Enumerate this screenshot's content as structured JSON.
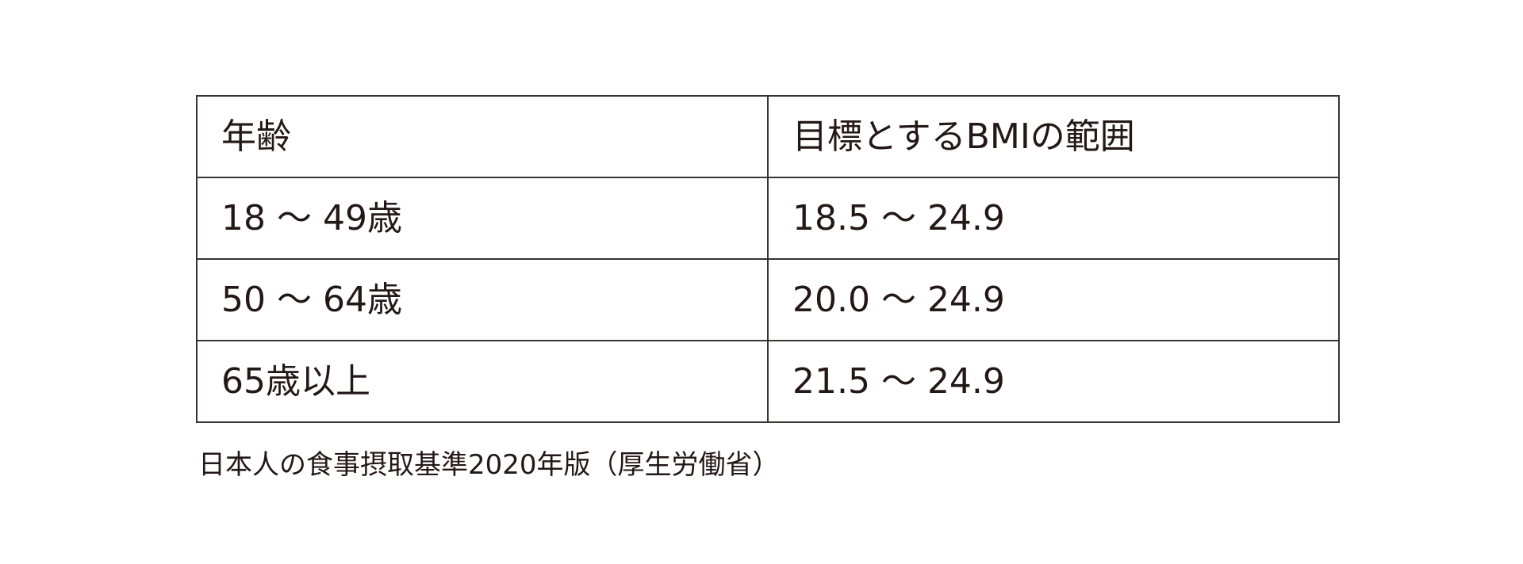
{
  "table": {
    "header": {
      "age": "年齢",
      "bmi_range": "目標とするBMIの範囲"
    },
    "rows": [
      {
        "age": "18 ～ 49歳",
        "bmi": "18.5 ～ 24.9"
      },
      {
        "age": "50 ～ 64歳",
        "bmi": "20.0 ～ 24.9"
      },
      {
        "age": "65歳以上",
        "bmi": "21.5 ～ 24.9"
      }
    ]
  },
  "source": "日本人の食事摂取基準2020年版（厚生労働省）",
  "colors": {
    "text": "#231815",
    "border": "#3a3233",
    "background": "#ffffff"
  }
}
